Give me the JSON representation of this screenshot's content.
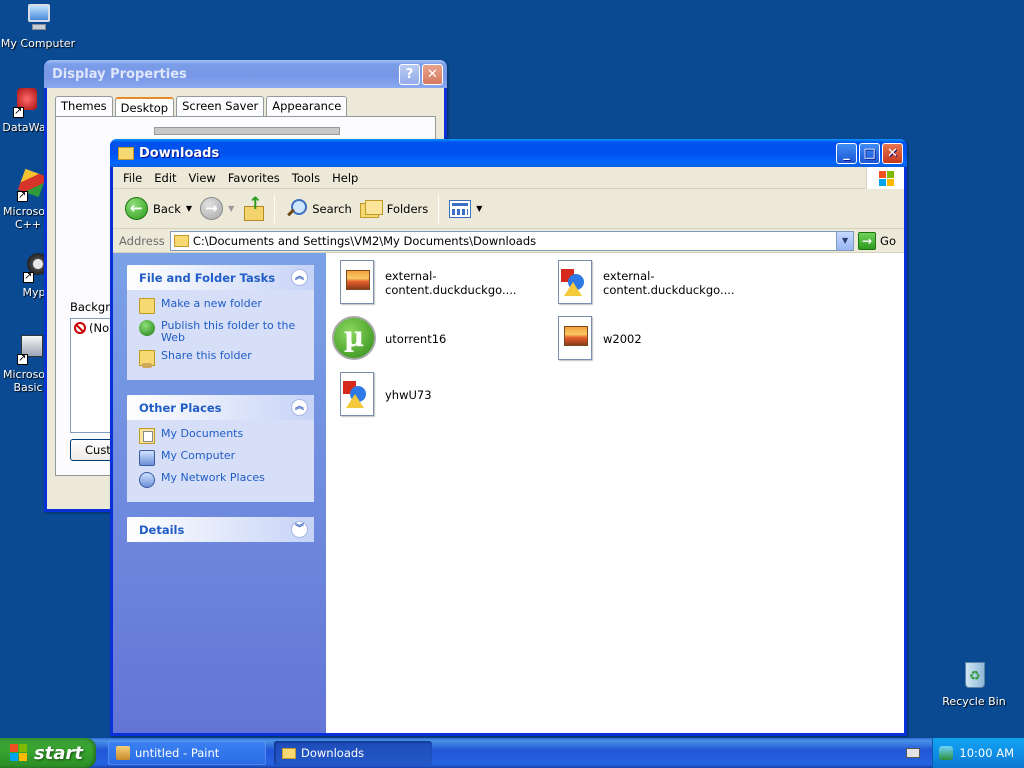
{
  "desktop": {
    "icons": [
      {
        "label": "My Computer"
      },
      {
        "label": "DataWa"
      },
      {
        "label": "Microsoft C++"
      },
      {
        "label": "Myp"
      },
      {
        "label": "Microsoft Basic"
      },
      {
        "label": "Recycle Bin"
      }
    ]
  },
  "display_properties": {
    "title": "Display Properties",
    "help_button": "?",
    "close_button": "✕",
    "tabs": [
      {
        "label": "Themes"
      },
      {
        "label": "Desktop"
      },
      {
        "label": "Screen Saver"
      },
      {
        "label": "Appearance"
      }
    ],
    "active_tab": "Desktop",
    "background_label": "Backgro",
    "background_item": "(No",
    "customize_button": "Custo"
  },
  "downloads": {
    "title": "Downloads",
    "title_buttons": {
      "minimize": "_",
      "maximize": "□",
      "close": "✕"
    },
    "menu": [
      "File",
      "Edit",
      "View",
      "Favorites",
      "Tools",
      "Help"
    ],
    "toolbar": {
      "back": "Back",
      "search": "Search",
      "folders": "Folders"
    },
    "address": {
      "label": "Address",
      "value": "C:\\Documents and Settings\\VM2\\My Documents\\Downloads",
      "go": "Go"
    },
    "tasks": {
      "file_folder": {
        "title": "File and Folder Tasks",
        "links": [
          "Make a new folder",
          "Publish this folder to the Web",
          "Share this folder"
        ]
      },
      "other_places": {
        "title": "Other Places",
        "links": [
          "My Documents",
          "My Computer",
          "My Network Places"
        ]
      },
      "details": {
        "title": "Details"
      }
    },
    "files": [
      {
        "name": "external-content.duckduckgo....",
        "icon": "jpg-image-icon"
      },
      {
        "name": "external-content.duckduckgo....",
        "icon": "image-file-icon"
      },
      {
        "name": "utorrent16",
        "icon": "utorrent-icon"
      },
      {
        "name": "w2002",
        "icon": "jpg-image-icon"
      },
      {
        "name": "yhwU73",
        "icon": "image-file-icon"
      }
    ]
  },
  "taskbar": {
    "start_label": "start",
    "tasks": [
      {
        "label": "untitled - Paint"
      },
      {
        "label": "Downloads"
      }
    ],
    "clock": "10:00 AM"
  },
  "colors": {
    "desktop_bg": "#0a4a93",
    "titlebar_active": "#0053ee",
    "taskpane_link": "#215dc6",
    "start_green": "#37a52f"
  }
}
